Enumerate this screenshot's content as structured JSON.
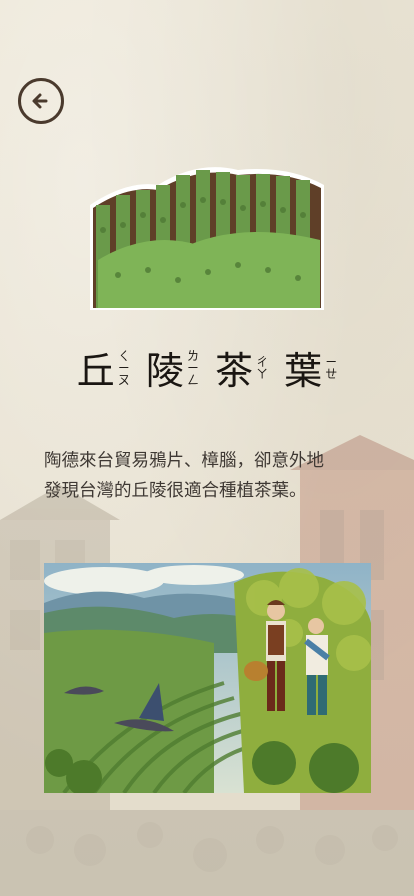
{
  "header": {
    "back_icon": "arrow-left-circle-icon"
  },
  "title": {
    "chars": [
      {
        "char": "丘",
        "zhuyin": [
          "ㄑ",
          "ㄧ",
          "ㄡ"
        ]
      },
      {
        "char": "陵",
        "zhuyin": [
          "ㄌ",
          "ㄧ",
          "ㄥ"
        ]
      },
      {
        "char": "茶",
        "zhuyin": [
          "ㄔ",
          "ㄚ"
        ]
      },
      {
        "char": "葉",
        "zhuyin": [
          "ㄧ",
          "ㄝ"
        ]
      }
    ]
  },
  "description": {
    "line1": "陶德來台貿易鴉片、樟腦，卻意外地",
    "line2": "發現台灣的丘陵很適合種植茶葉。"
  },
  "colors": {
    "tea_green": "#6a9a4a",
    "soil": "#6b4a2f",
    "ink": "#1a1612"
  }
}
